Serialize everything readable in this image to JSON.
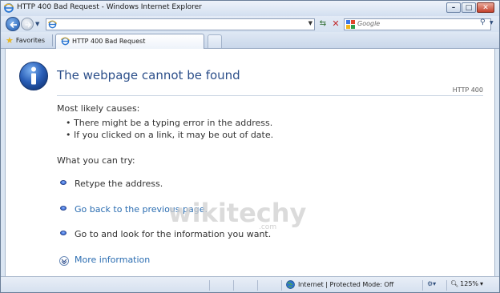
{
  "window": {
    "title": "HTTP 400 Bad Request - Windows Internet Explorer",
    "controls": [
      "minimize",
      "maximize",
      "close"
    ]
  },
  "addressbar": {
    "url": "",
    "icons": [
      "ie-page-icon",
      "dropdown-icon",
      "refresh-icon",
      "stop-icon"
    ]
  },
  "search": {
    "placeholder": "Google"
  },
  "favorites": {
    "label": "Favorites"
  },
  "tab": {
    "label": "HTTP 400 Bad Request"
  },
  "page": {
    "heading": "The webpage cannot be found",
    "code": "HTTP 400",
    "causes_title": "Most likely causes:",
    "causes": [
      "There might be a typing error in the address.",
      "If you clicked on a link, it may be out of date."
    ],
    "try_title": "What you can try:",
    "try_items": [
      "Retype the address.",
      "Go back to the previous page.",
      "Go to  and look for the information you want."
    ],
    "more_info": "More information",
    "watermark": "wikitechy",
    "watermark_suffix": ".com"
  },
  "statusbar": {
    "zone": "Internet | Protected Mode: Off",
    "zoom": "125%"
  },
  "colors": {
    "heading": "#2c4f8a",
    "link": "#2b6db1",
    "frame": "#dbe6f3"
  }
}
